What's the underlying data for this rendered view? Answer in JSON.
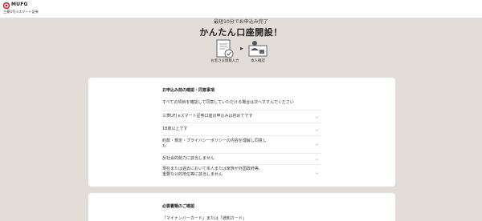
{
  "brand": {
    "name": "MUFG",
    "subtitle": "三菱UFJ eスマート証券",
    "accent": "#d7000f"
  },
  "hero": {
    "subtitle": "最短10分でお申込み完了",
    "title": "かんたん口座開設！",
    "steps": [
      {
        "icon": "document-check-icon",
        "label": "お客さま情報入力"
      },
      {
        "icon": "id-card-icon",
        "label": "本人確認"
      }
    ],
    "arrow": "▶"
  },
  "confirm_card": {
    "title": "お申込み前の確認・同意事項",
    "intro": "すべての項目を確認して同意していただける場合は次へすすんでください",
    "questions": [
      "三菱UFJ eスマート証券口座の申込みは初めてです",
      "18歳以上です",
      "約款・規定・プライバシーポリシーの内容を理解し同意した",
      "反社会的勢力に該当しません",
      "現在または過去において本人または家族が外国政府等、重要な公的地位等に該当しません"
    ]
  },
  "docs_card": {
    "title": "必要書類のご確認",
    "line": "「マイナンバーカード」または「通知カード」"
  }
}
